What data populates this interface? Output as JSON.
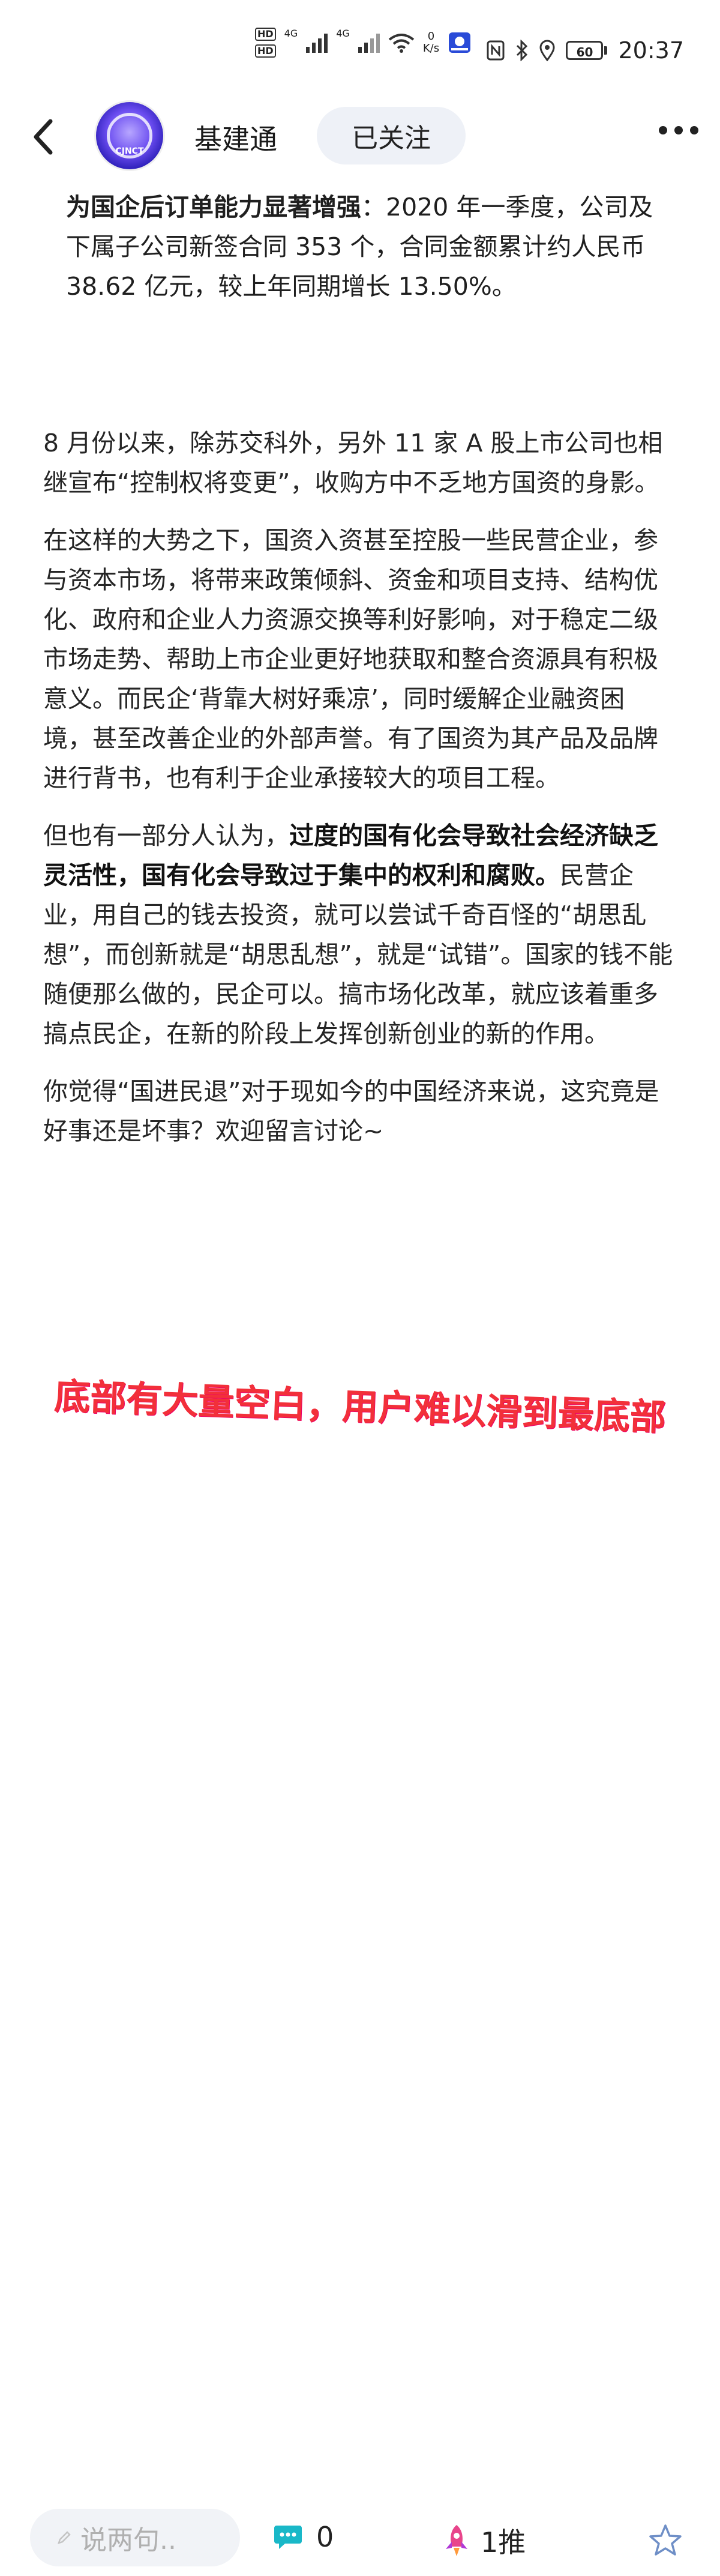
{
  "status_bar": {
    "hd1": "HD",
    "hd2": "HD",
    "net1": "4G",
    "net2": "4G",
    "speed_value": "0",
    "speed_unit": "K/s",
    "battery": "60",
    "time": "20:37"
  },
  "nav": {
    "avatar_text": "CJNCT",
    "title": "基建通",
    "follow_label": "已关注"
  },
  "article": {
    "top_bold": "为国企后订单能力显著增强",
    "top_rest": "：2020 年一季度，公司及下属子公司新签合同 353 个，合同金额累计约人民币 38.62 亿元，较上年同期增长 13.50%。",
    "p1": "8 月份以来，除苏交科外，另外 11 家 A 股上市公司也相继宣布“控制权将变更”，收购方中不乏地方国资的身影。",
    "p2": "在这样的大势之下，国资入资甚至控股一些民营企业，参与资本市场，将带来政策倾斜、资金和项目支持、结构优化、政府和企业人力资源交换等利好影响，对于稳定二级市场走势、帮助上市企业更好地获取和整合资源具有积极意义。而民企‘背靠大树好乘凉’，同时缓解企业融资困境，甚至改善企业的外部声誉。有了国资为其产品及品牌进行背书，也有利于企业承接较大的项目工程。",
    "p3_start": "但也有一部分人认为，",
    "p3_bold": "过度的国有化会导致社会经济缺乏灵活性，国有化会导致过于集中的权利和腐败。",
    "p3_end": "民营企业，用自己的钱去投资，就可以尝试千奇百怪的“胡思乱想”，而创新就是“胡思乱想”，就是“试错”。国家的钱不能随便那么做的，民企可以。搞市场化改革，就应该着重多搞点民企，在新的阶段上发挥创新创业的新的作用。",
    "p4": "你觉得“国进民退”对于现如今的中国经济来说，这究竟是好事还是坏事？欢迎留言讨论~"
  },
  "annotation": {
    "text": "底部有大量空白，用户难以滑到最底部"
  },
  "bottom_bar": {
    "input_placeholder": "说两句..",
    "comment_count": "0",
    "push_label": "1推"
  },
  "colors": {
    "annotation_red": "#f2303a",
    "follow_bg": "#eef1f7",
    "comment_teal": "#19b8c8",
    "rocket_pink": "#e8458b"
  },
  "icons": [
    "back-arrow-icon",
    "more-icon",
    "pen-icon",
    "comment-icon",
    "rocket-icon",
    "star-icon",
    "wifi-icon",
    "signal-icon",
    "nfc-icon",
    "bluetooth-icon",
    "location-icon",
    "battery-icon"
  ]
}
